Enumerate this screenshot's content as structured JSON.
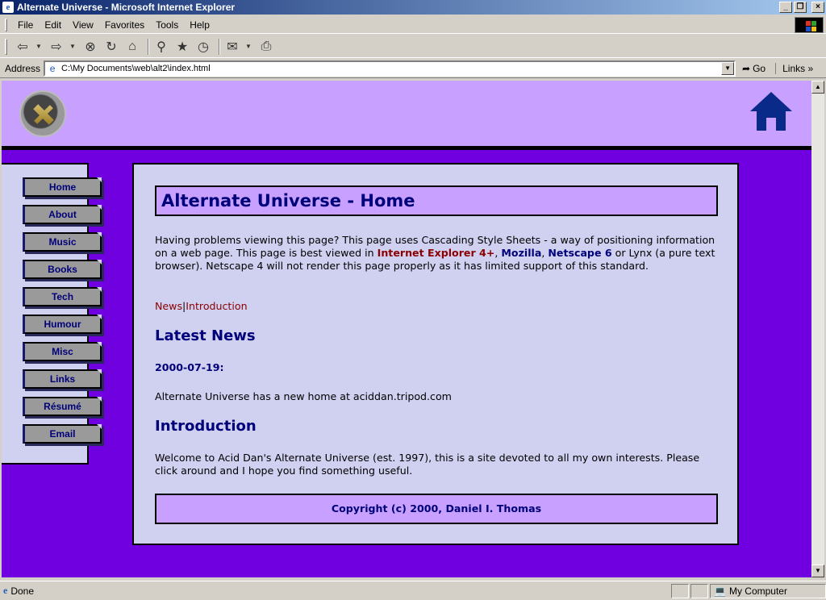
{
  "window": {
    "title": "Alternate Universe - Microsoft Internet Explorer",
    "buttons": {
      "minimize": "_",
      "maximize": "❐",
      "close": "×"
    }
  },
  "menu": {
    "items": [
      "File",
      "Edit",
      "View",
      "Favorites",
      "Tools",
      "Help"
    ]
  },
  "toolbar": {
    "icons": [
      "back-arrow-icon",
      "forward-arrow-icon",
      "stop-icon",
      "refresh-icon",
      "home-icon",
      "search-icon",
      "favorites-icon",
      "history-icon",
      "mail-icon",
      "print-icon"
    ]
  },
  "address": {
    "label": "Address",
    "url": "C:\\My Documents\\web\\alt2\\index.html",
    "go_label": "Go",
    "links_label": "Links"
  },
  "site": {
    "nav": [
      "Home",
      "About",
      "Music",
      "Books",
      "Tech",
      "Humour",
      "Misc",
      "Links",
      "Résumé",
      "Email"
    ],
    "page_title": "Alternate Universe - Home",
    "intro_text_1": "Having problems viewing this page? This page uses Cascading Style Sheets - a way of positioning information on a web page. This page is best viewed in ",
    "browser_ie": "Internet Explorer 4+",
    "comma_1": ", ",
    "browser_mozilla": "Mozilla",
    "comma_2": ", ",
    "browser_netscape6": "Netscape 6",
    "intro_text_2": " or Lynx (a pure text browser). Netscape 4 will not render this page properly as it has limited support of this standard.",
    "tab_news": "News",
    "tab_separator": "|",
    "tab_intro": "Introduction",
    "latest_news_heading": "Latest News",
    "news_date": "2000-07-19:",
    "news_text": "Alternate Universe has a new home at aciddan.tripod.com",
    "introduction_heading": "Introduction",
    "introduction_text": "Welcome to Acid Dan's Alternate Universe (est. 1997), this is a site devoted to all my own interests. Please click around and I hope you find something useful.",
    "footer": "Copyright (c) 2000, Daniel I. Thomas"
  },
  "status": {
    "text": "Done",
    "zone": "My Computer"
  },
  "colors": {
    "page_bg": "#7000e0",
    "header_bg": "#c8a0ff",
    "panel_bg": "#d0d0f0",
    "heading": "#00007a",
    "link": "#8b0000"
  }
}
